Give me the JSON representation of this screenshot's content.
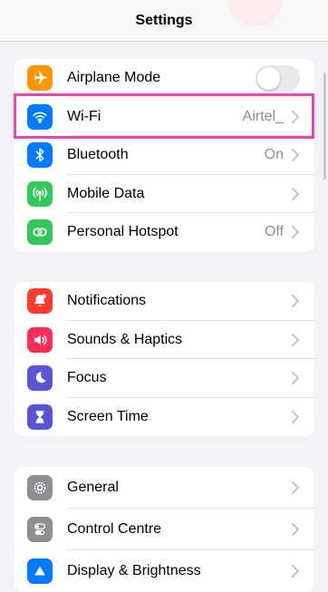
{
  "nav": {
    "title": "Settings"
  },
  "groups": [
    {
      "rows": [
        {
          "label": "Airplane Mode",
          "icon": "airplane-icon",
          "color": "#ff9500",
          "toggle": false
        },
        {
          "label": "Wi-Fi",
          "value": "Airtel_",
          "icon": "wifi-icon",
          "color": "#007aff",
          "highlighted": true
        },
        {
          "label": "Bluetooth",
          "value": "On",
          "icon": "bluetooth-icon",
          "color": "#007aff"
        },
        {
          "label": "Mobile Data",
          "icon": "antenna-icon",
          "color": "#34c759"
        },
        {
          "label": "Personal Hotspot",
          "value": "Off",
          "icon": "hotspot-icon",
          "color": "#34c759"
        }
      ]
    },
    {
      "rows": [
        {
          "label": "Notifications",
          "icon": "bell-icon",
          "color": "#ff3b30"
        },
        {
          "label": "Sounds & Haptics",
          "icon": "speaker-icon",
          "color": "#ff2d55"
        },
        {
          "label": "Focus",
          "icon": "moon-icon",
          "color": "#5856d6"
        },
        {
          "label": "Screen Time",
          "icon": "hourglass-icon",
          "color": "#5856d6"
        }
      ]
    },
    {
      "rows": [
        {
          "label": "General",
          "icon": "gear-icon",
          "color": "#8e8e93"
        },
        {
          "label": "Control Centre",
          "icon": "toggles-icon",
          "color": "#8e8e93"
        },
        {
          "label": "Display & Brightness",
          "icon": "display-icon",
          "color": "#007aff"
        }
      ]
    }
  ]
}
